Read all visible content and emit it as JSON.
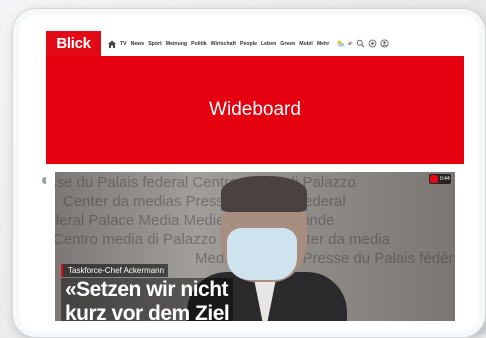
{
  "nav": {
    "logo": "Blick",
    "links": [
      "TV",
      "News",
      "Sport",
      "Meinung",
      "Politik",
      "Wirtschaft",
      "People",
      "Leben",
      "Green",
      "Mobil",
      "Mehr"
    ],
    "weather_temp": "4°"
  },
  "ad": {
    "label": "Wideboard"
  },
  "video": {
    "watermark_lines": [
      "sse du Palais federal  Centro media di Palazzo",
      "Center da medias  Presse federala  Federal",
      "deral Palace Media  Medienzentrum Bunde",
      "Centro media di Palazzo  federale  Center da media",
      "Medienzentrum  Presse du Palais fédéra"
    ],
    "live_time": "0:44",
    "kicker": "Taskforce-Chef Ackermann",
    "headline": "«Setzen wir nicht\nkurz vor dem Ziel"
  },
  "colors": {
    "brand_red": "#e20a17"
  }
}
